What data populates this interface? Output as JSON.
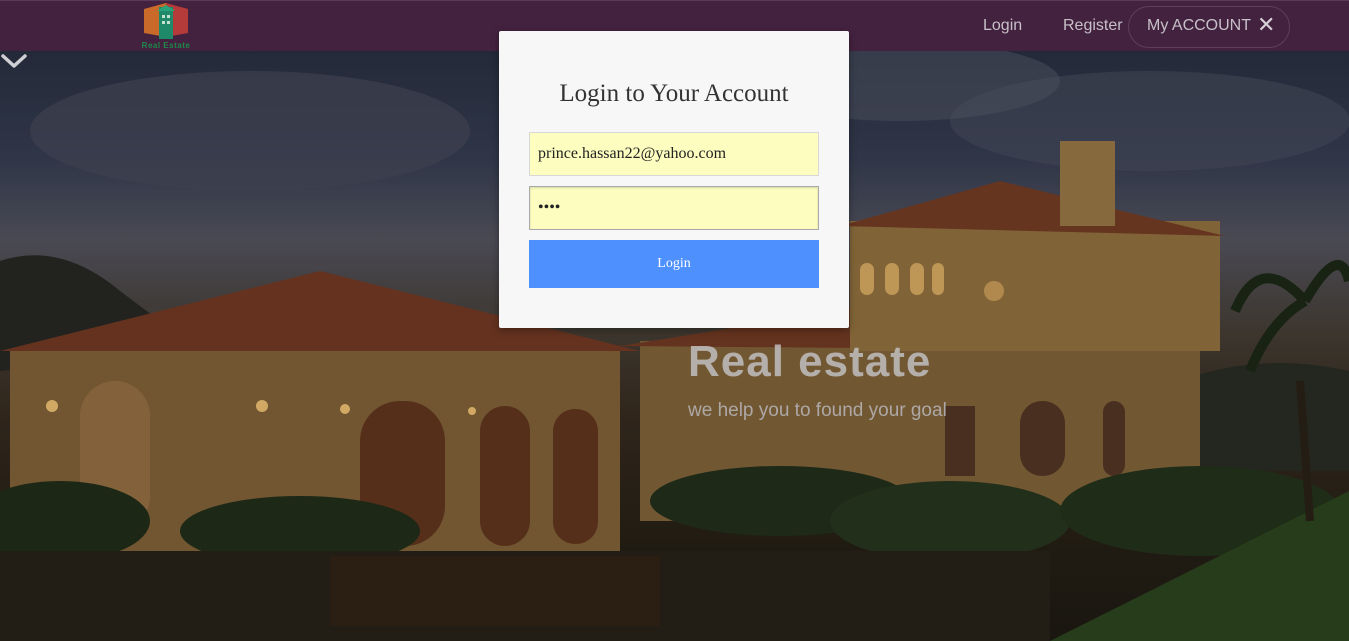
{
  "navbar": {
    "logo_text": "Real Estate",
    "links": [
      "Login",
      "Register"
    ],
    "account_label": "My ACCOUNT",
    "account_close_icon": "close-icon"
  },
  "hero": {
    "title": "Real estate",
    "tagline": "we help you to found your goal",
    "scroll_icon": "chevron-down-icon"
  },
  "login_modal": {
    "title": "Login to Your Account",
    "email_value": "prince.hassan22@yahoo.com",
    "password_value": "••••",
    "submit_label": "Login"
  },
  "colors": {
    "navbar_bg": "#43223f",
    "modal_bg": "#f7f7f7",
    "autofill_bg": "#fcfdbf",
    "button_bg": "#4d90fe"
  }
}
